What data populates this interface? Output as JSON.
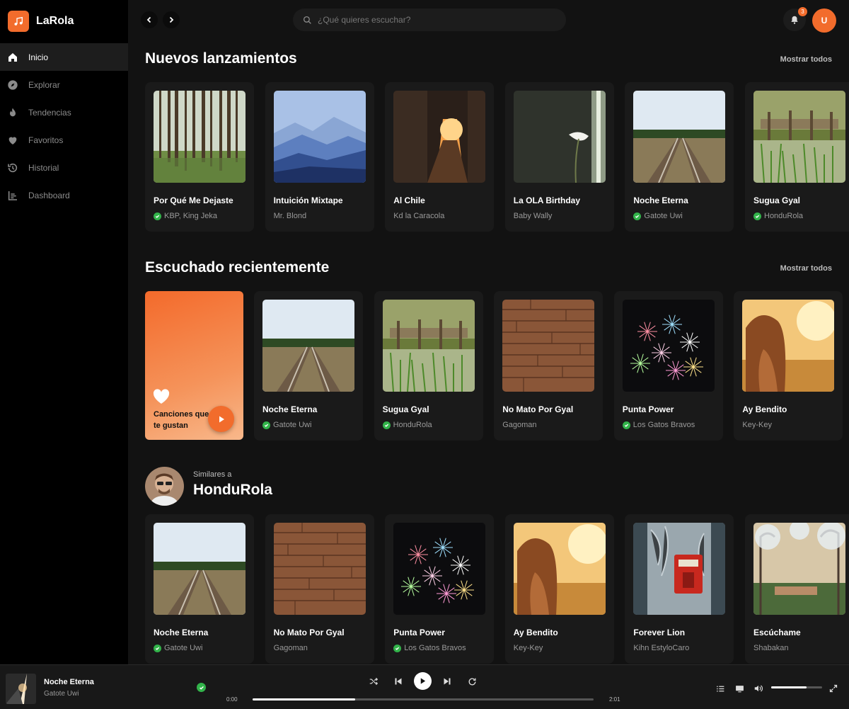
{
  "app": {
    "name": "LaRola",
    "accent": "#f26c2c"
  },
  "sidebar": {
    "items": [
      {
        "label": "Inicio",
        "icon": "home-icon",
        "active": true
      },
      {
        "label": "Explorar",
        "icon": "compass-icon"
      },
      {
        "label": "Tendencias",
        "icon": "flame-icon"
      },
      {
        "label": "Favoritos",
        "icon": "heart-icon"
      },
      {
        "label": "Historial",
        "icon": "history-icon"
      },
      {
        "label": "Dashboard",
        "icon": "chart-icon"
      }
    ]
  },
  "topbar": {
    "search_placeholder": "¿Qué quieres escuchar?",
    "notifications_count": "3",
    "user_initial": "U"
  },
  "new_releases": {
    "title": "Nuevos lanzamientos",
    "show_all": "Mostrar todos",
    "cards": [
      {
        "title": "Por Qué Me Dejaste",
        "artist": "KBP, King Jeka",
        "verified": true,
        "art": "forest"
      },
      {
        "title": "Intuición Mixtape",
        "artist": "Mr. Blond",
        "verified": false,
        "art": "mountains"
      },
      {
        "title": "Al Chile",
        "artist": "Kd la Caracola",
        "verified": false,
        "art": "city"
      },
      {
        "title": "La OLA Birthday",
        "artist": "Baby Wally",
        "verified": false,
        "art": "flower"
      },
      {
        "title": "Noche Eterna",
        "artist": "Gatote Uwi",
        "verified": true,
        "art": "rails"
      },
      {
        "title": "Sugua Gyal",
        "artist": "HonduRola",
        "verified": true,
        "art": "dock"
      }
    ]
  },
  "recent": {
    "title": "Escuchado recientemente",
    "show_all": "Mostrar todos",
    "favorites_label": "Canciones que te gustan",
    "cards": [
      {
        "title": "Noche Eterna",
        "artist": "Gatote Uwi",
        "verified": true,
        "art": "rails"
      },
      {
        "title": "Sugua Gyal",
        "artist": "HonduRola",
        "verified": true,
        "art": "dock"
      },
      {
        "title": "No Mato Por Gyal",
        "artist": "Gagoman",
        "verified": false,
        "art": "wood"
      },
      {
        "title": "Punta Power",
        "artist": "Los Gatos Bravos",
        "verified": true,
        "art": "fireworks"
      },
      {
        "title": "Ay Bendito",
        "artist": "Key-Key",
        "verified": false,
        "art": "sunset"
      }
    ]
  },
  "similar": {
    "label": "Similares a",
    "artist": "HonduRola",
    "cards": [
      {
        "title": "Noche Eterna",
        "artist": "Gatote Uwi",
        "verified": true,
        "art": "rails"
      },
      {
        "title": "No Mato Por Gyal",
        "artist": "Gagoman",
        "verified": false,
        "art": "wood"
      },
      {
        "title": "Punta Power",
        "artist": "Los Gatos Bravos",
        "verified": true,
        "art": "fireworks"
      },
      {
        "title": "Ay Bendito",
        "artist": "Key-Key",
        "verified": false,
        "art": "sunset"
      },
      {
        "title": "Forever Lion",
        "artist": "Kihn EstyloCaro",
        "verified": false,
        "art": "phone"
      },
      {
        "title": "Escúchame",
        "artist": "Shabakan",
        "verified": false,
        "art": "trees"
      }
    ]
  },
  "player": {
    "title": "Noche Eterna",
    "artist": "Gatote Uwi",
    "current_time": "0:00",
    "duration": "2:01",
    "progress": 0.3,
    "volume": 0.7
  }
}
